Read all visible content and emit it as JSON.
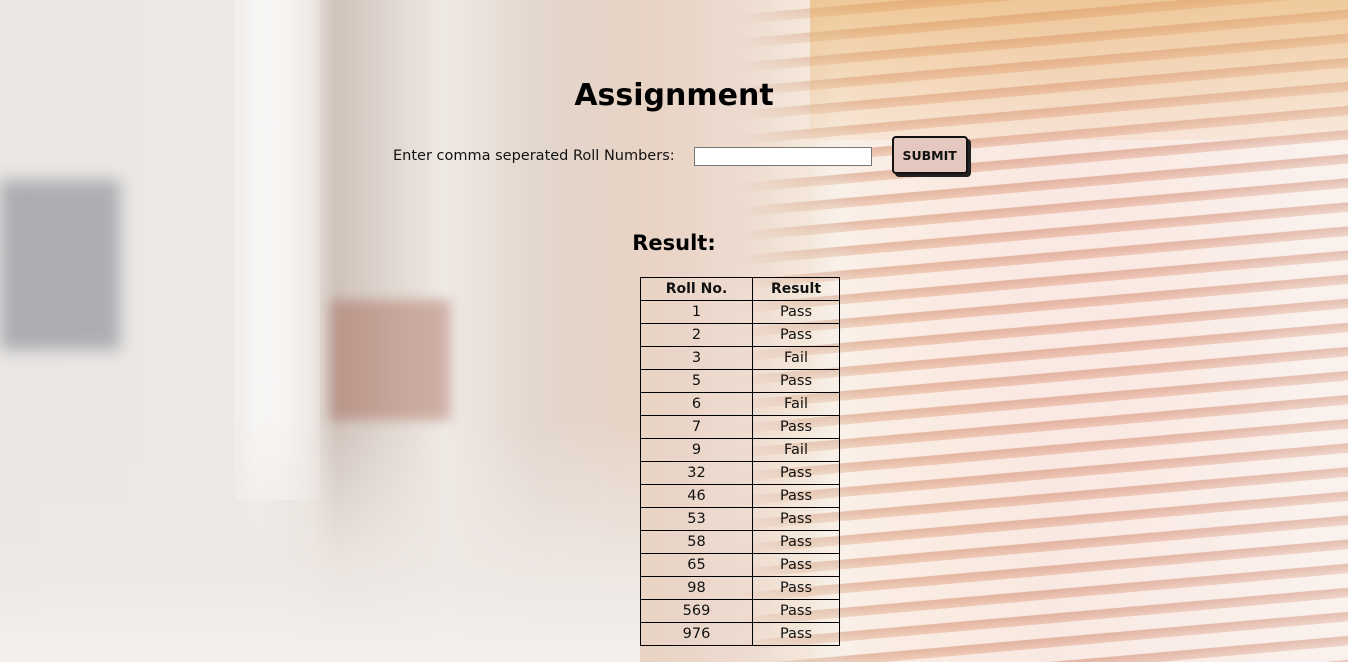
{
  "page": {
    "title": "Assignment",
    "form": {
      "label": "Enter comma seperated Roll Numbers:",
      "input_value": "",
      "input_placeholder": "",
      "submit_label": "SUBMIT"
    },
    "result_heading": "Result:",
    "table": {
      "headers": [
        "Roll No.",
        "Result"
      ],
      "rows": [
        {
          "roll": "1",
          "result": "Pass"
        },
        {
          "roll": "2",
          "result": "Pass"
        },
        {
          "roll": "3",
          "result": "Fail"
        },
        {
          "roll": "5",
          "result": "Pass"
        },
        {
          "roll": "6",
          "result": "Fail"
        },
        {
          "roll": "7",
          "result": "Pass"
        },
        {
          "roll": "9",
          "result": "Fail"
        },
        {
          "roll": "32",
          "result": "Pass"
        },
        {
          "roll": "46",
          "result": "Pass"
        },
        {
          "roll": "53",
          "result": "Pass"
        },
        {
          "roll": "58",
          "result": "Pass"
        },
        {
          "roll": "65",
          "result": "Pass"
        },
        {
          "roll": "98",
          "result": "Pass"
        },
        {
          "roll": "569",
          "result": "Pass"
        },
        {
          "roll": "976",
          "result": "Pass"
        }
      ]
    }
  },
  "colors": {
    "button_bg": "#e4c8bf",
    "text": "#000000"
  }
}
